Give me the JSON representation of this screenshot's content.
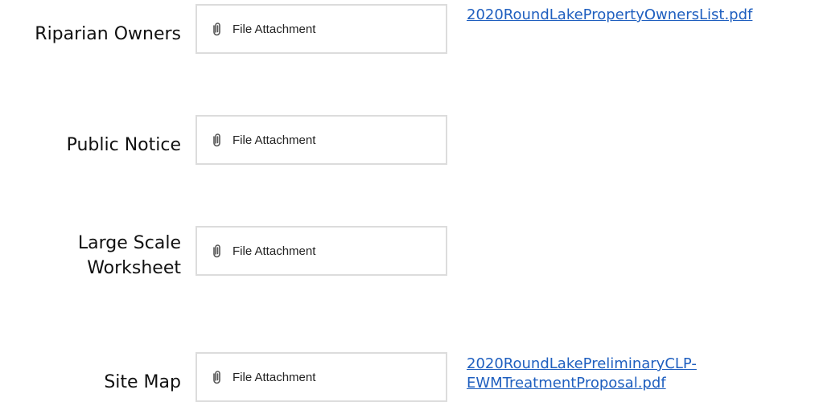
{
  "rows": [
    {
      "label": "Riparian Owners",
      "attachment_label": "File Attachment",
      "links": [
        "2020RoundLakePropertyOwnersList.pdf"
      ]
    },
    {
      "label": "Public Notice",
      "attachment_label": "File Attachment",
      "links": []
    },
    {
      "label_lines": [
        "Large Scale",
        "Worksheet"
      ],
      "attachment_label": "File Attachment",
      "links": []
    },
    {
      "label": "Site Map",
      "attachment_label": "File Attachment",
      "links": [
        "2020RoundLakePreliminaryCLP-",
        "EWMTreatmentProposal.pdf"
      ]
    }
  ],
  "icons": {
    "attachment": "paperclip-icon"
  },
  "colors": {
    "link": "#1f5fbf",
    "border": "#dcdcdc",
    "text": "#111111"
  }
}
